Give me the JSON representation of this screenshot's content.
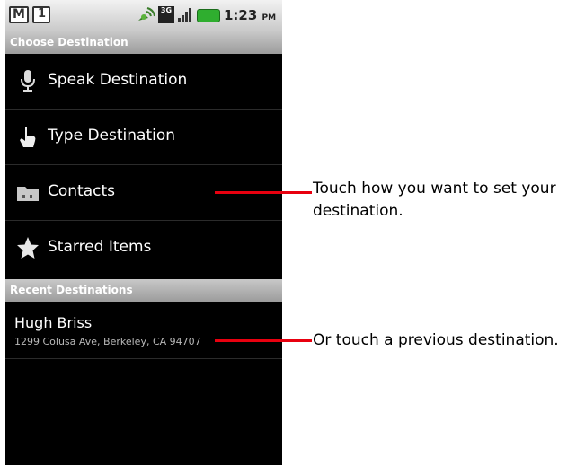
{
  "statusbar": {
    "icons": [
      "gmail-icon",
      "calendar-icon",
      "gps-icon",
      "3g-icon",
      "signal-icon",
      "battery-icon"
    ],
    "threeg": "3G",
    "time": "1:23",
    "ampm": "PM"
  },
  "choose_header": "Choose Destination",
  "menu": [
    {
      "label": "Speak Destination",
      "icon": "microphone-icon"
    },
    {
      "label": "Type Destination",
      "icon": "hand-pointer-icon"
    },
    {
      "label": "Contacts",
      "icon": "contacts-folder-icon"
    },
    {
      "label": "Starred Items",
      "icon": "star-icon"
    }
  ],
  "recent_header": "Recent Destinations",
  "recent": [
    {
      "name": "Hugh Briss",
      "address": "1299 Colusa Ave, Berkeley, CA 94707"
    }
  ],
  "annotations": {
    "note1_line1": "Touch how you want to set your",
    "note1_line2": "destination.",
    "note2": "Or touch a previous destination."
  },
  "colors": {
    "callout": "#e8000f",
    "battery": "#2fae2f"
  }
}
